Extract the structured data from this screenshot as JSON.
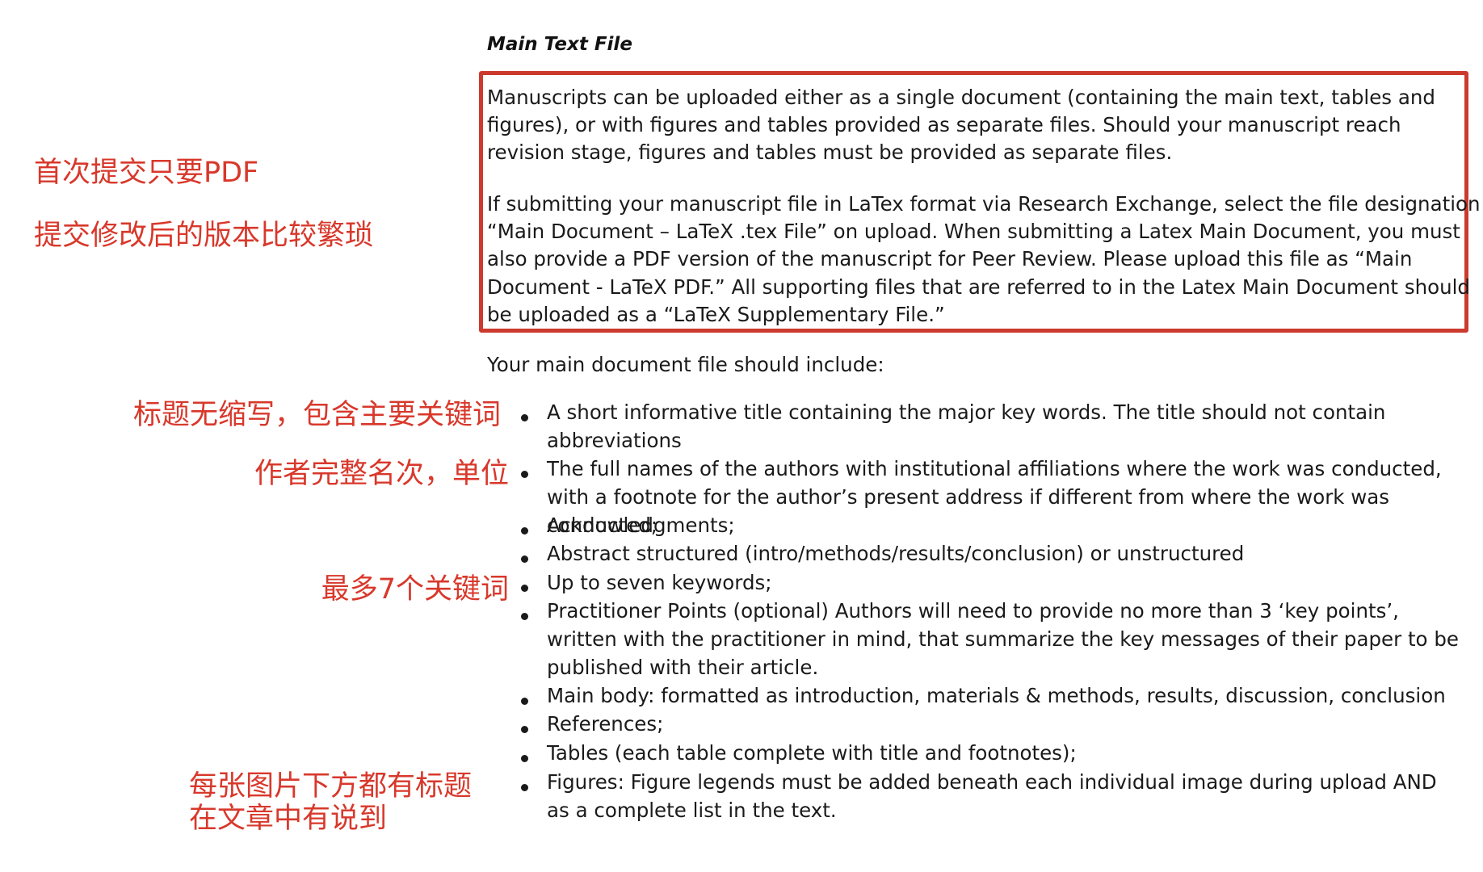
{
  "section": {
    "heading": "Main Text File"
  },
  "boxed": {
    "paragraph_1": "Manuscripts can be uploaded either as a single document (containing the main text, tables and figures), or with figures and tables provided as separate files. Should your manuscript reach revision stage, figures and tables must be provided as separate files.",
    "paragraph_2": "If submitting your manuscript file in LaTex format via Research Exchange, select the file designation “Main Document – LaTeX .tex File” on upload. When submitting a Latex Main Document, you must also provide a PDF version of the manuscript for Peer Review. Please upload this file as “Main Document - LaTeX PDF.” All supporting files that are referred to in the Latex Main Document should be uploaded as a “LaTeX Supplementary File.”"
  },
  "intro": "Your main document file should include:",
  "bullets": [
    "A short informative title containing the major key words. The title should not contain abbreviations",
    "The full names of the authors with institutional affiliations where the work was conducted, with a footnote for the author’s present address if different from where the work was conducted;",
    "Acknowledgments;",
    "Abstract structured (intro/methods/results/conclusion) or unstructured",
    "Up to seven keywords;",
    "Practitioner Points (optional) Authors will need to provide no more than 3 ‘key points’, written with the practitioner in mind, that summarize the key messages of their paper to be published with their article.",
    "Main body: formatted as introduction, materials & methods, results, discussion, conclusion",
    "References;",
    "Tables (each table complete with title and footnotes);",
    "Figures: Figure legends must be added beneath each individual image during upload AND as a complete list in the text."
  ],
  "annotations": {
    "first_submission": "首次提交只要PDF",
    "revision_submission": "提交修改后的版本比较繁琐",
    "title_note": "标题无缩写，包含主要关键词",
    "authors_note": "作者完整名次，单位",
    "keywords_note": "最多7个关键词",
    "figures_note_line1": "每张图片下方都有标题",
    "figures_note_line2": "在文章中有说到"
  },
  "colors": {
    "annotation_red": "#d8382b",
    "box_border": "#cc3a2e",
    "text": "#1a1a1a"
  }
}
